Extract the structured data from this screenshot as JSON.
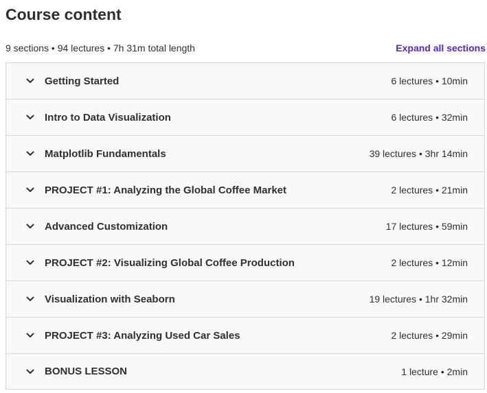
{
  "header": {
    "title": "Course content",
    "summary": "9 sections • 94 lectures • 7h 31m total length",
    "expand_label": "Expand all sections"
  },
  "colors": {
    "accent": "#5624d0",
    "text": "#2d2f31",
    "section_bg": "#f7f9fa",
    "border": "#d1d7dc"
  },
  "sections": [
    {
      "title": "Getting Started",
      "info": "6 lectures • 10min",
      "icon": "chevron-down-icon"
    },
    {
      "title": "Intro to Data Visualization",
      "info": "6 lectures • 32min",
      "icon": "chevron-down-icon"
    },
    {
      "title": "Matplotlib Fundamentals",
      "info": "39 lectures • 3hr 14min",
      "icon": "chevron-down-icon"
    },
    {
      "title": "PROJECT #1: Analyzing the Global Coffee Market",
      "info": "2 lectures • 21min",
      "icon": "chevron-down-icon"
    },
    {
      "title": "Advanced Customization",
      "info": "17 lectures • 59min",
      "icon": "chevron-down-icon"
    },
    {
      "title": "PROJECT #2: Visualizing Global Coffee Production",
      "info": "2 lectures • 12min",
      "icon": "chevron-down-icon"
    },
    {
      "title": "Visualization with Seaborn",
      "info": "19 lectures • 1hr 32min",
      "icon": "chevron-down-icon"
    },
    {
      "title": "PROJECT #3: Analyzing Used Car Sales",
      "info": "2 lectures • 29min",
      "icon": "chevron-down-icon"
    },
    {
      "title": "BONUS LESSON",
      "info": "1 lecture • 2min",
      "icon": "chevron-down-icon"
    }
  ]
}
